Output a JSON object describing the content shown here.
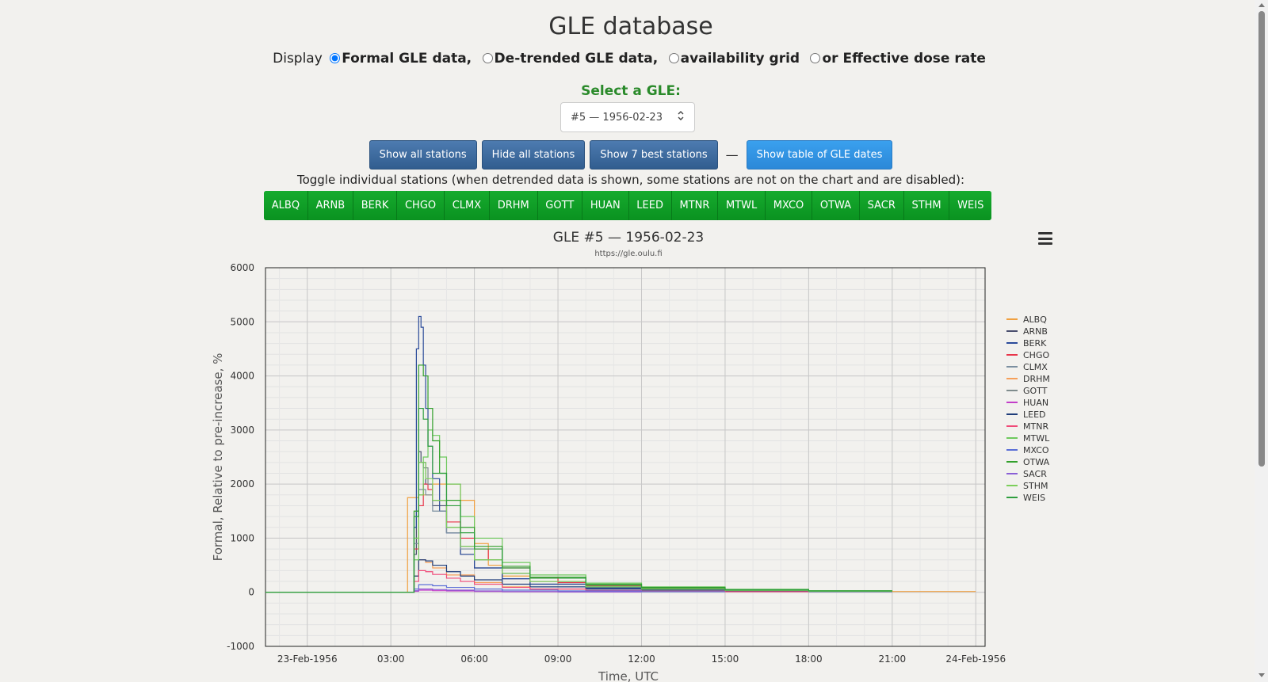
{
  "page": {
    "title": "GLE database"
  },
  "display": {
    "prefix": "Display",
    "options": [
      {
        "label": "Formal GLE data,",
        "checked": true
      },
      {
        "label": "De-trended GLE data,",
        "checked": false
      },
      {
        "label": "availability grid",
        "checked": false
      },
      {
        "label": "or Effective dose rate",
        "checked": false
      }
    ]
  },
  "gle_select": {
    "label": "Select a GLE:",
    "value": "#5 — 1956-02-23"
  },
  "buttons": {
    "show_all": "Show all stations",
    "hide_all": "Hide all stations",
    "show_best": "Show 7 best stations",
    "separator": "—",
    "show_table": "Show table of GLE dates"
  },
  "toggle_help": "Toggle individual stations (when detrended data is shown, some stations are not on the chart and are disabled):",
  "stations": [
    "ALBQ",
    "ARNB",
    "BERK",
    "CHGO",
    "CLMX",
    "DRHM",
    "GOTT",
    "HUAN",
    "LEED",
    "MTNR",
    "MTWL",
    "MXCO",
    "OTWA",
    "SACR",
    "STHM",
    "WEIS"
  ],
  "chart_data": {
    "type": "line",
    "title": "GLE #5 — 1956-02-23",
    "subtitle": "https://gle.oulu.fi",
    "xlabel": "Time, UTC",
    "ylabel": "Formal, Relative to pre-increase, %",
    "xlim": [
      "1956-02-22T22:30",
      "1956-02-24T00:20"
    ],
    "ylim": [
      -1000,
      6000
    ],
    "yticks": [
      -1000,
      0,
      1000,
      2000,
      3000,
      4000,
      5000,
      6000
    ],
    "xticks": [
      {
        "t": "1956-02-23T00:00",
        "label": "23-Feb-1956"
      },
      {
        "t": "1956-02-23T03:00",
        "label": "03:00"
      },
      {
        "t": "1956-02-23T06:00",
        "label": "06:00"
      },
      {
        "t": "1956-02-23T09:00",
        "label": "09:00"
      },
      {
        "t": "1956-02-23T12:00",
        "label": "12:00"
      },
      {
        "t": "1956-02-23T15:00",
        "label": "15:00"
      },
      {
        "t": "1956-02-23T18:00",
        "label": "18:00"
      },
      {
        "t": "1956-02-23T21:00",
        "label": "21:00"
      },
      {
        "t": "1956-02-24T00:00",
        "label": "24-Feb-1956"
      }
    ],
    "grid": true,
    "legend_position": "right",
    "series": [
      {
        "name": "ALBQ",
        "color": "#f0a040",
        "end": "1956-02-24T00:00",
        "x": [
          "1956-02-22T22:30",
          "1956-02-23T03:30",
          "1956-02-23T03:36",
          "1956-02-23T03:45",
          "1956-02-23T04:00",
          "1956-02-23T04:30",
          "1956-02-23T05:00",
          "1956-02-23T05:30",
          "1956-02-23T06:00",
          "1956-02-23T06:30",
          "1956-02-23T07:00",
          "1956-02-23T08:00",
          "1956-02-23T09:00",
          "1956-02-23T10:00",
          "1956-02-23T12:00",
          "1956-02-23T15:00",
          "1956-02-23T18:00",
          "1956-02-23T21:00"
        ],
        "y": [
          0,
          0,
          1750,
          1750,
          1800,
          2000,
          2000,
          1700,
          900,
          500,
          300,
          200,
          150,
          100,
          60,
          40,
          25,
          15
        ]
      },
      {
        "name": "ARNB",
        "color": "#4a4f6e",
        "end": "1956-02-23T21:00",
        "x": [
          "1956-02-22T22:30",
          "1956-02-23T03:45",
          "1956-02-23T03:50",
          "1956-02-23T03:55",
          "1956-02-23T04:00",
          "1956-02-23T04:05",
          "1956-02-23T04:15",
          "1956-02-23T04:30",
          "1956-02-23T05:00",
          "1956-02-23T05:30",
          "1956-02-23T06:00",
          "1956-02-23T07:00",
          "1956-02-23T08:00",
          "1956-02-23T10:00",
          "1956-02-23T12:00",
          "1956-02-23T15:00",
          "1956-02-23T18:00"
        ],
        "y": [
          0,
          0,
          700,
          1500,
          2600,
          2400,
          2000,
          1600,
          1100,
          700,
          450,
          250,
          150,
          80,
          50,
          30,
          15
        ]
      },
      {
        "name": "BERK",
        "color": "#2a4a9a",
        "end": "1956-02-23T21:00",
        "x": [
          "1956-02-22T22:30",
          "1956-02-23T03:45",
          "1956-02-23T03:50",
          "1956-02-23T03:55",
          "1956-02-23T04:00",
          "1956-02-23T04:05",
          "1956-02-23T04:10",
          "1956-02-23T04:15",
          "1956-02-23T04:20",
          "1956-02-23T04:30",
          "1956-02-23T04:45",
          "1956-02-23T05:00",
          "1956-02-23T05:30",
          "1956-02-23T06:00",
          "1956-02-23T07:00",
          "1956-02-23T08:00",
          "1956-02-23T10:00",
          "1956-02-23T12:00",
          "1956-02-23T15:00",
          "1956-02-23T18:00"
        ],
        "y": [
          0,
          0,
          1200,
          4500,
          5100,
          4900,
          4200,
          3400,
          2700,
          2100,
          1500,
          1100,
          700,
          450,
          250,
          150,
          80,
          50,
          30,
          15
        ]
      },
      {
        "name": "CHGO",
        "color": "#e8354a",
        "end": "1956-02-23T21:00",
        "x": [
          "1956-02-22T22:30",
          "1956-02-23T03:45",
          "1956-02-23T03:50",
          "1956-02-23T04:00",
          "1956-02-23T04:10",
          "1956-02-23T04:20",
          "1956-02-23T04:30",
          "1956-02-23T05:00",
          "1956-02-23T05:30",
          "1956-02-23T06:00",
          "1956-02-23T06:30",
          "1956-02-23T07:00",
          "1956-02-23T08:00",
          "1956-02-23T09:00",
          "1956-02-23T10:00",
          "1956-02-23T12:00",
          "1956-02-23T15:00",
          "1956-02-23T18:00"
        ],
        "y": [
          0,
          0,
          800,
          1600,
          2000,
          1900,
          1700,
          1300,
          1000,
          800,
          600,
          450,
          280,
          180,
          120,
          70,
          40,
          20
        ]
      },
      {
        "name": "CLMX",
        "color": "#7b8fa0",
        "end": "1956-02-23T21:00",
        "x": [
          "1956-02-22T22:30",
          "1956-02-23T03:45",
          "1956-02-23T03:50",
          "1956-02-23T04:00",
          "1956-02-23T04:15",
          "1956-02-23T04:30",
          "1956-02-23T05:00",
          "1956-02-23T05:30",
          "1956-02-23T06:00",
          "1956-02-23T07:00",
          "1956-02-23T08:00",
          "1956-02-23T10:00",
          "1956-02-23T12:00",
          "1956-02-23T15:00",
          "1956-02-23T18:00"
        ],
        "y": [
          0,
          0,
          900,
          1900,
          1800,
          1500,
          1100,
          800,
          600,
          350,
          200,
          100,
          60,
          35,
          20
        ]
      },
      {
        "name": "DRHM",
        "color": "#f6a05a",
        "end": "1956-02-23T15:00",
        "x": [
          "1956-02-22T22:30",
          "1956-02-23T03:45",
          "1956-02-23T03:50",
          "1956-02-23T04:00",
          "1956-02-23T04:15",
          "1956-02-23T04:30",
          "1956-02-23T05:00",
          "1956-02-23T06:00",
          "1956-02-23T07:00",
          "1956-02-23T08:00",
          "1956-02-23T10:00",
          "1956-02-23T12:00"
        ],
        "y": [
          0,
          0,
          300,
          600,
          550,
          450,
          320,
          180,
          100,
          60,
          30,
          15
        ]
      },
      {
        "name": "GOTT",
        "color": "#7f8c8d",
        "end": "1956-02-23T21:00",
        "x": [
          "1956-02-22T22:30",
          "1956-02-23T03:45",
          "1956-02-23T03:50",
          "1956-02-23T04:00",
          "1956-02-23T04:10",
          "1956-02-23T04:20",
          "1956-02-23T04:30",
          "1956-02-23T05:00",
          "1956-02-23T05:30",
          "1956-02-23T06:00",
          "1956-02-23T07:00",
          "1956-02-23T08:00",
          "1956-02-23T10:00",
          "1956-02-23T12:00",
          "1956-02-23T15:00",
          "1956-02-23T18:00"
        ],
        "y": [
          0,
          0,
          1000,
          2400,
          2300,
          2000,
          1700,
          1200,
          850,
          600,
          350,
          200,
          100,
          60,
          35,
          20
        ]
      },
      {
        "name": "HUAN",
        "color": "#c33ec9",
        "end": "1956-02-23T12:00",
        "x": [
          "1956-02-22T22:30",
          "1956-02-23T03:45",
          "1956-02-23T03:50",
          "1956-02-23T04:00",
          "1956-02-23T04:30",
          "1956-02-23T05:00",
          "1956-02-23T06:00",
          "1956-02-23T07:00",
          "1956-02-23T09:00"
        ],
        "y": [
          0,
          0,
          20,
          40,
          30,
          25,
          15,
          10,
          5
        ]
      },
      {
        "name": "LEED",
        "color": "#1f3d7a",
        "end": "1956-02-23T21:00",
        "x": [
          "1956-02-22T22:30",
          "1956-02-23T03:45",
          "1956-02-23T03:50",
          "1956-02-23T04:00",
          "1956-02-23T04:15",
          "1956-02-23T04:30",
          "1956-02-23T05:00",
          "1956-02-23T05:30",
          "1956-02-23T06:00",
          "1956-02-23T07:00",
          "1956-02-23T08:00",
          "1956-02-23T10:00",
          "1956-02-23T12:00",
          "1956-02-23T15:00",
          "1956-02-23T18:00"
        ],
        "y": [
          0,
          0,
          300,
          600,
          580,
          500,
          380,
          300,
          230,
          150,
          100,
          60,
          40,
          25,
          15
        ]
      },
      {
        "name": "MTNR",
        "color": "#f04a78",
        "end": "1956-02-23T18:00",
        "x": [
          "1956-02-22T22:30",
          "1956-02-23T03:45",
          "1956-02-23T03:50",
          "1956-02-23T04:00",
          "1956-02-23T04:15",
          "1956-02-23T04:30",
          "1956-02-23T05:00",
          "1956-02-23T05:30",
          "1956-02-23T06:00",
          "1956-02-23T07:00",
          "1956-02-23T08:00",
          "1956-02-23T10:00",
          "1956-02-23T12:00",
          "1956-02-23T15:00"
        ],
        "y": [
          0,
          0,
          200,
          400,
          380,
          330,
          260,
          200,
          150,
          90,
          60,
          35,
          20,
          10
        ]
      },
      {
        "name": "MTWL",
        "color": "#6ec95e",
        "end": "1956-02-23T21:00",
        "x": [
          "1956-02-22T22:30",
          "1956-02-23T03:45",
          "1956-02-23T03:50",
          "1956-02-23T04:00",
          "1956-02-23T04:10",
          "1956-02-23T04:20",
          "1956-02-23T04:30",
          "1956-02-23T04:45",
          "1956-02-23T05:00",
          "1956-02-23T05:30",
          "1956-02-23T06:00",
          "1956-02-23T07:00",
          "1956-02-23T08:00",
          "1956-02-23T10:00",
          "1956-02-23T12:00",
          "1956-02-23T15:00",
          "1956-02-23T18:00"
        ],
        "y": [
          0,
          0,
          600,
          1800,
          2500,
          3000,
          2900,
          2500,
          2000,
          1400,
          1000,
          550,
          320,
          170,
          100,
          55,
          30
        ]
      },
      {
        "name": "MXCO",
        "color": "#5b6fd6",
        "end": "1956-02-23T15:00",
        "x": [
          "1956-02-22T22:30",
          "1956-02-23T03:45",
          "1956-02-23T03:50",
          "1956-02-23T04:00",
          "1956-02-23T04:30",
          "1956-02-23T05:00",
          "1956-02-23T06:00",
          "1956-02-23T07:00",
          "1956-02-23T09:00",
          "1956-02-23T12:00"
        ],
        "y": [
          0,
          0,
          60,
          140,
          120,
          90,
          60,
          40,
          25,
          10
        ]
      },
      {
        "name": "OTWA",
        "color": "#33a02c",
        "end": "1956-02-23T21:00",
        "x": [
          "1956-02-22T22:30",
          "1956-02-23T03:45",
          "1956-02-23T03:50",
          "1956-02-23T04:00",
          "1956-02-23T04:10",
          "1956-02-23T04:20",
          "1956-02-23T04:30",
          "1956-02-23T04:45",
          "1956-02-23T05:00",
          "1956-02-23T05:30",
          "1956-02-23T06:00",
          "1956-02-23T07:00",
          "1956-02-23T08:00",
          "1956-02-23T10:00",
          "1956-02-23T12:00",
          "1956-02-23T15:00",
          "1956-02-23T18:00"
        ],
        "y": [
          0,
          0,
          1500,
          4200,
          4000,
          3400,
          2800,
          2200,
          1700,
          1200,
          850,
          480,
          280,
          150,
          90,
          50,
          25
        ]
      },
      {
        "name": "SACR",
        "color": "#8a5fd6",
        "end": "1956-02-23T12:00",
        "x": [
          "1956-02-22T22:30",
          "1956-02-23T03:45",
          "1956-02-23T03:50",
          "1956-02-23T04:00",
          "1956-02-23T04:30",
          "1956-02-23T05:00",
          "1956-02-23T06:00",
          "1956-02-23T07:00",
          "1956-02-23T09:00"
        ],
        "y": [
          0,
          0,
          30,
          60,
          50,
          40,
          25,
          15,
          8
        ]
      },
      {
        "name": "STHM",
        "color": "#7ccf5a",
        "end": "1956-02-23T21:00",
        "x": [
          "1956-02-22T22:30",
          "1956-02-23T03:45",
          "1956-02-23T03:50",
          "1956-02-23T04:00",
          "1956-02-23T04:15",
          "1956-02-23T04:30",
          "1956-02-23T05:00",
          "1956-02-23T05:30",
          "1956-02-23T06:00",
          "1956-02-23T07:00",
          "1956-02-23T08:00",
          "1956-02-23T10:00",
          "1956-02-23T12:00",
          "1956-02-23T15:00",
          "1956-02-23T18:00"
        ],
        "y": [
          0,
          0,
          1000,
          2400,
          2100,
          1700,
          1200,
          850,
          600,
          350,
          200,
          100,
          60,
          35,
          20
        ]
      },
      {
        "name": "WEIS",
        "color": "#2e9e3e",
        "end": "1956-02-23T21:00",
        "x": [
          "1956-02-22T22:30",
          "1956-02-23T03:45",
          "1956-02-23T03:50",
          "1956-02-23T04:00",
          "1956-02-23T04:10",
          "1956-02-23T04:20",
          "1956-02-23T04:30",
          "1956-02-23T05:00",
          "1956-02-23T05:30",
          "1956-02-23T06:00",
          "1956-02-23T07:00",
          "1956-02-23T08:00",
          "1956-02-23T10:00",
          "1956-02-23T12:00",
          "1956-02-23T15:00",
          "1956-02-23T18:00"
        ],
        "y": [
          0,
          0,
          1400,
          3400,
          3200,
          2700,
          2200,
          1600,
          1100,
          800,
          450,
          260,
          130,
          80,
          45,
          25
        ]
      }
    ]
  }
}
